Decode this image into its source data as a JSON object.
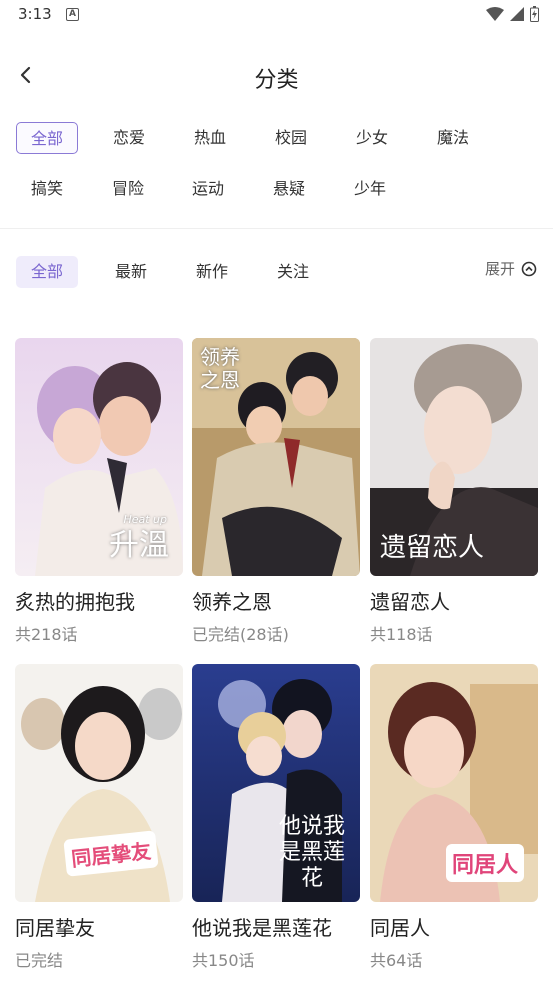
{
  "status": {
    "time": "3:13"
  },
  "header": {
    "title": "分类"
  },
  "genres": [
    "全部",
    "恋爱",
    "热血",
    "校园",
    "少女",
    "魔法",
    "搞笑",
    "冒险",
    "运动",
    "悬疑",
    "少年"
  ],
  "sorts": [
    "全部",
    "最新",
    "新作",
    "关注"
  ],
  "expand_label": "展开",
  "comics": [
    {
      "title": "炙热的拥抱我",
      "sub": "共218话",
      "cover_text": "升溫",
      "cover_en": "Heat up"
    },
    {
      "title": "领养之恩",
      "sub": "已完结(28话)",
      "cover_text": "领养之恩",
      "cover_en": ""
    },
    {
      "title": "遗留恋人",
      "sub": "共118话",
      "cover_text": "遗留恋人",
      "cover_en": ""
    },
    {
      "title": "同居挚友",
      "sub": "已完结",
      "cover_text": "同居挚友",
      "cover_en": ""
    },
    {
      "title": "他说我是黑莲花",
      "sub": "共150话",
      "cover_text": "他说我是黑莲花",
      "cover_en": ""
    },
    {
      "title": "同居人",
      "sub": "共64话",
      "cover_text": "同居人",
      "cover_en": ""
    }
  ]
}
